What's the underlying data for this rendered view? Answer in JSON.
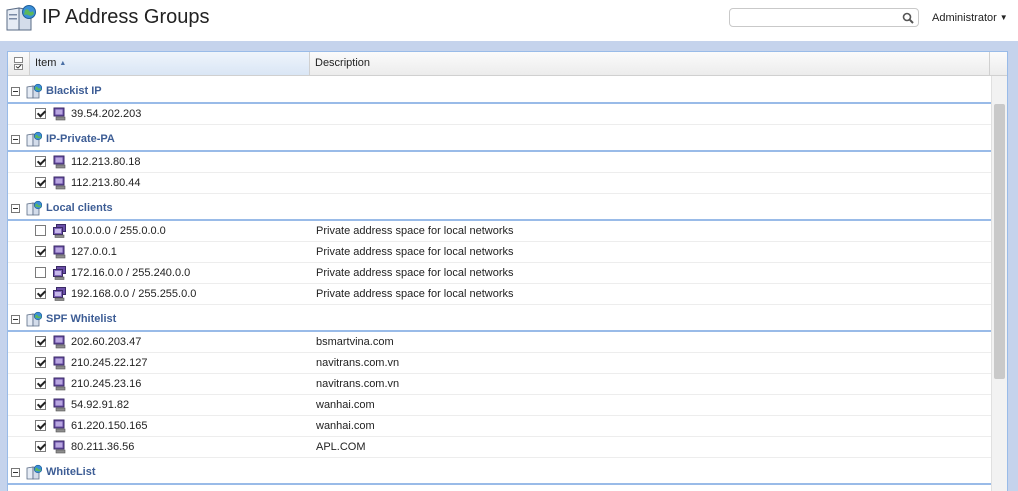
{
  "header": {
    "title": "IP Address Groups",
    "search_placeholder": "",
    "user": "Administrator"
  },
  "grid": {
    "columns": {
      "item": "Item",
      "description": "Description"
    },
    "groups": [
      {
        "label": "Blackist IP",
        "rows": [
          {
            "checked": true,
            "item": "39.54.202.203",
            "desc": "",
            "icon": "computer-icon"
          }
        ]
      },
      {
        "label": "IP-Private-PA",
        "rows": [
          {
            "checked": true,
            "item": "112.213.80.18",
            "desc": "",
            "icon": "computer-icon"
          },
          {
            "checked": true,
            "item": "112.213.80.44",
            "desc": "",
            "icon": "computer-icon"
          }
        ]
      },
      {
        "label": "Local clients",
        "rows": [
          {
            "checked": false,
            "item": "10.0.0.0 / 255.0.0.0",
            "desc": "Private address space for local networks",
            "icon": "network-icon"
          },
          {
            "checked": true,
            "item": "127.0.0.1",
            "desc": "Private address space for local networks",
            "icon": "computer-icon"
          },
          {
            "checked": false,
            "item": "172.16.0.0 / 255.240.0.0",
            "desc": "Private address space for local networks",
            "icon": "network-icon"
          },
          {
            "checked": true,
            "item": "192.168.0.0 / 255.255.0.0",
            "desc": "Private address space for local networks",
            "icon": "network-icon"
          }
        ]
      },
      {
        "label": "SPF Whitelist",
        "rows": [
          {
            "checked": true,
            "item": "202.60.203.47",
            "desc": "bsmartvina.com",
            "icon": "computer-icon"
          },
          {
            "checked": true,
            "item": "210.245.22.127",
            "desc": "navitrans.com.vn",
            "icon": "computer-icon"
          },
          {
            "checked": true,
            "item": "210.245.23.16",
            "desc": "navitrans.com.vn",
            "icon": "computer-icon"
          },
          {
            "checked": true,
            "item": "54.92.91.82",
            "desc": "wanhai.com",
            "icon": "computer-icon"
          },
          {
            "checked": true,
            "item": "61.220.150.165",
            "desc": "wanhai.com",
            "icon": "computer-icon"
          },
          {
            "checked": true,
            "item": "80.211.36.56",
            "desc": "APL.COM",
            "icon": "computer-icon"
          }
        ]
      },
      {
        "label": "WhiteList",
        "rows": []
      }
    ]
  },
  "colors": {
    "group_text": "#3d5d95",
    "group_rule": "#99bbe8",
    "frame_bg": "#c5d3ec"
  }
}
